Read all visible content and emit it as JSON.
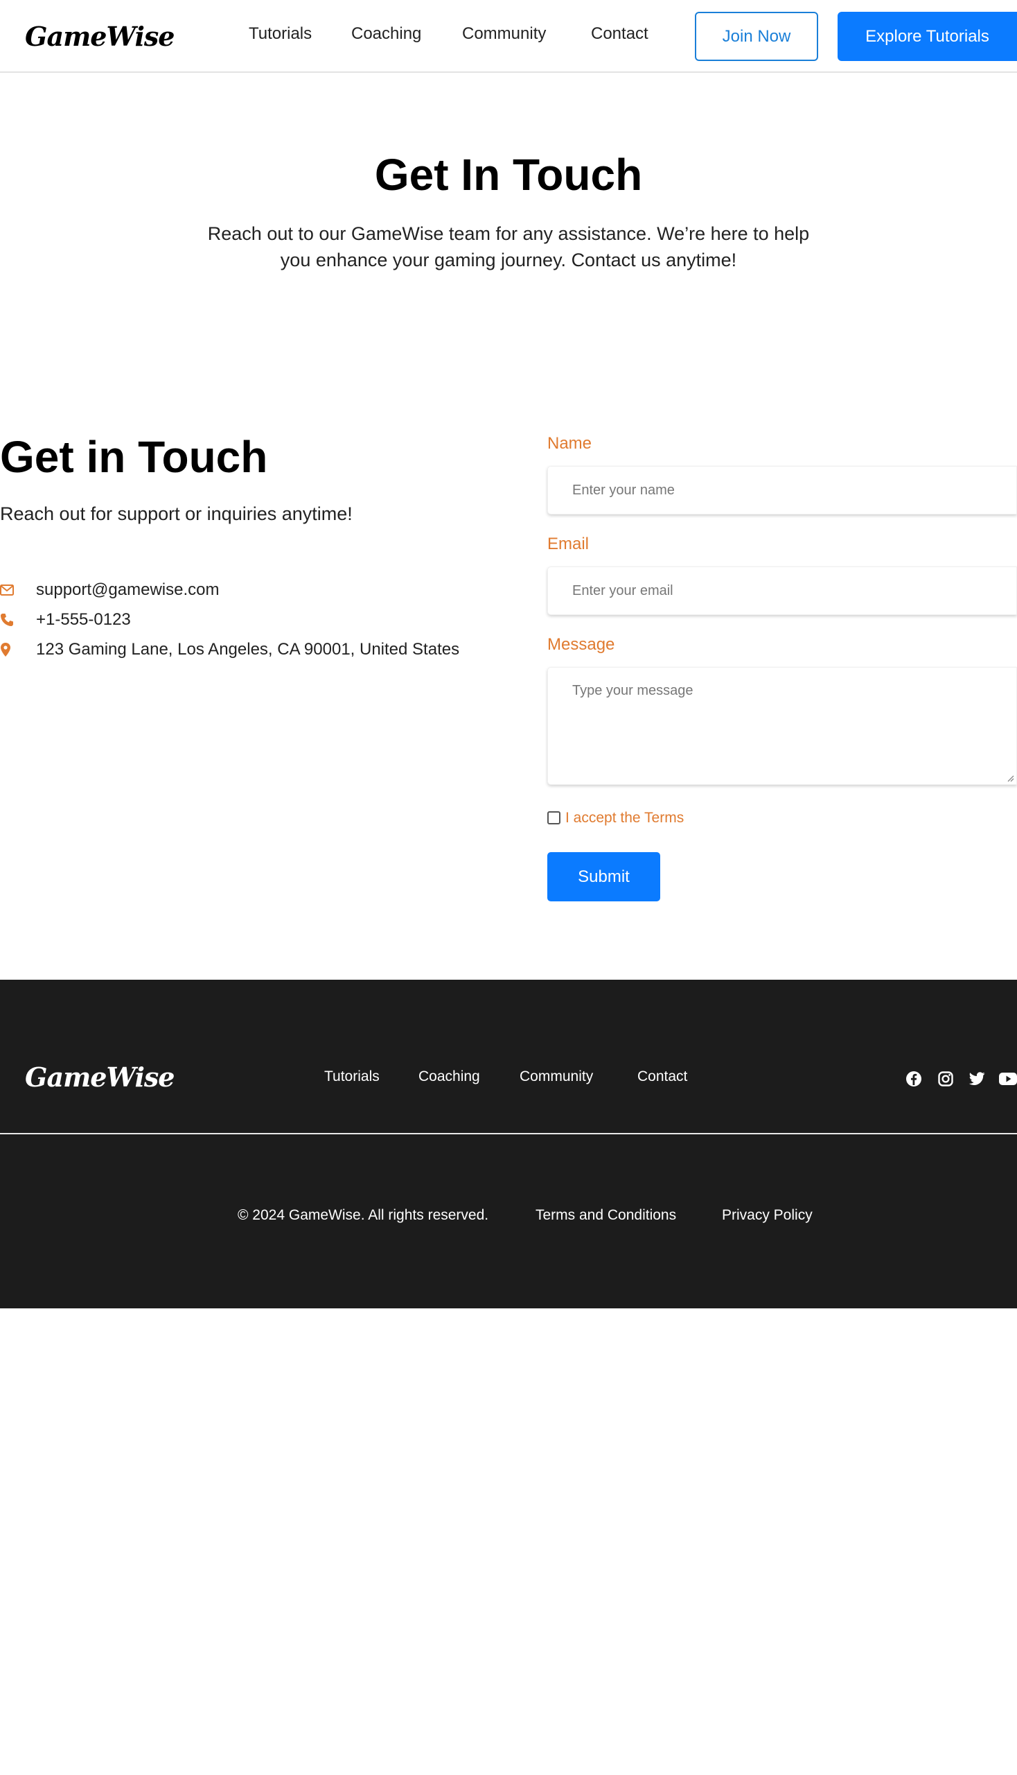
{
  "header": {
    "logo": "GameWise",
    "nav": [
      "Tutorials",
      "Coaching",
      "Community",
      "Contact"
    ],
    "join_label": "Join Now",
    "explore_label": "Explore Tutorials"
  },
  "hero": {
    "title": "Get In Touch",
    "subtitle": "Reach out to our GameWise team for any assistance. We’re here to help you enhance your gaming journey. Contact us anytime!"
  },
  "contact": {
    "title": "Get in Touch",
    "subtitle": "Reach out for support or inquiries anytime!",
    "email": "support@gamewise.com",
    "phone": "+1-555-0123",
    "address": "123 Gaming Lane, Los Angeles, CA 90001, United States",
    "icons": [
      "envelope-icon",
      "phone-icon",
      "location-pin-icon"
    ],
    "icon_color": "#e07b30"
  },
  "form": {
    "name_label": "Name",
    "name_placeholder": "Enter your name",
    "name_value": "",
    "email_label": "Email",
    "email_placeholder": "Enter your email",
    "email_value": "",
    "message_label": "Message",
    "message_placeholder": "Type your message",
    "message_value": "",
    "terms_label": "I accept the Terms",
    "terms_checked": false,
    "submit_label": "Submit",
    "label_color": "#e07b30"
  },
  "footer": {
    "logo": "GameWise",
    "nav": [
      "Tutorials",
      "Coaching",
      "Community",
      "Contact"
    ],
    "social": [
      "facebook-icon",
      "instagram-icon",
      "twitter-icon",
      "youtube-icon"
    ],
    "copyright": "© 2024 GameWise. All rights reserved.",
    "terms": "Terms and Conditions",
    "privacy": "Privacy Policy",
    "background": "#1c1c1c"
  },
  "colors": {
    "accent_blue": "#0b7bff",
    "accent_orange": "#e07b30"
  }
}
